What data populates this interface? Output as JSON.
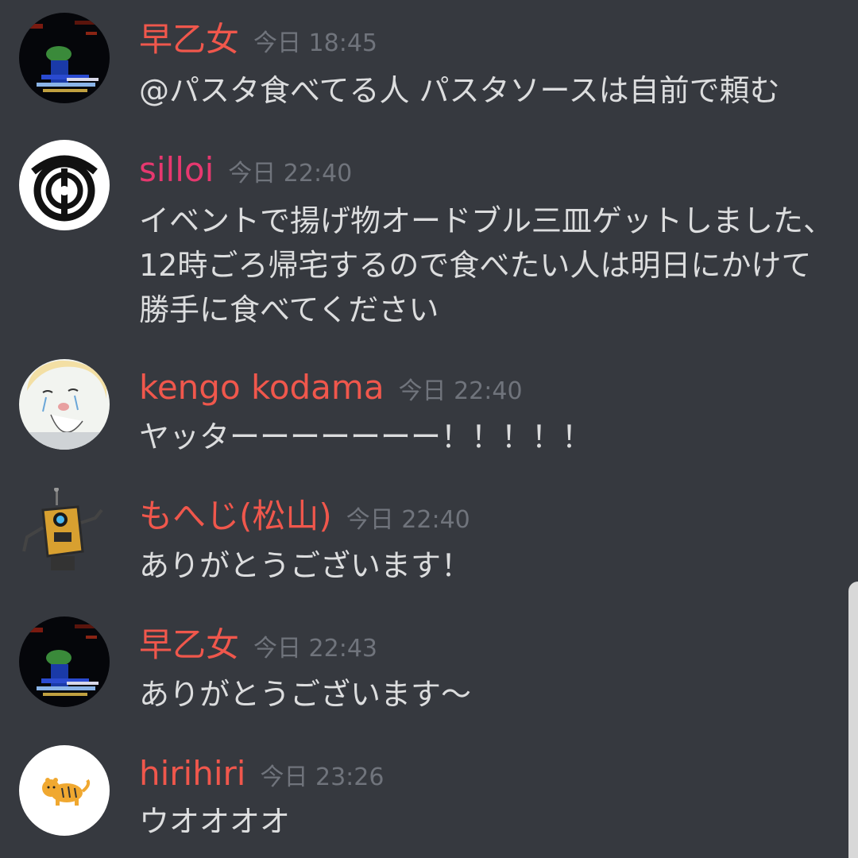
{
  "messages": [
    {
      "username": "早乙女",
      "timestamp": "今日 18:45",
      "text": "@パスタ食べてる人 パスタソースは自前で頼む",
      "avatar": "glitch-landscape-avatar"
    },
    {
      "username": "silloi",
      "timestamp": "今日 22:40",
      "text": "イベントで揚げ物オードブル三皿ゲットしました、12時ごろ帰宅するので食べたい人は明日にかけて勝手に食べてください",
      "avatar": "emblem-avatar"
    },
    {
      "username": "kengo kodama",
      "timestamp": "今日 22:40",
      "text": "ヤッターーーーーーー！！！！！",
      "avatar": "crying-character-avatar"
    },
    {
      "username": "もへじ(松山)",
      "timestamp": "今日 22:40",
      "text": "ありがとうございます！",
      "avatar": "robot-avatar"
    },
    {
      "username": "早乙女",
      "timestamp": "今日 22:43",
      "text": "ありがとうございます～",
      "avatar": "glitch-landscape-avatar"
    },
    {
      "username": "hirihiri",
      "timestamp": "今日 23:26",
      "text": "ウオオオオ",
      "avatar": "tiger-avatar"
    }
  ],
  "colors": {
    "background": "#36393f",
    "username_red": "#f0574c",
    "username_pink": "#e6386f",
    "timestamp": "#70747c",
    "message_text": "#dcddde"
  }
}
